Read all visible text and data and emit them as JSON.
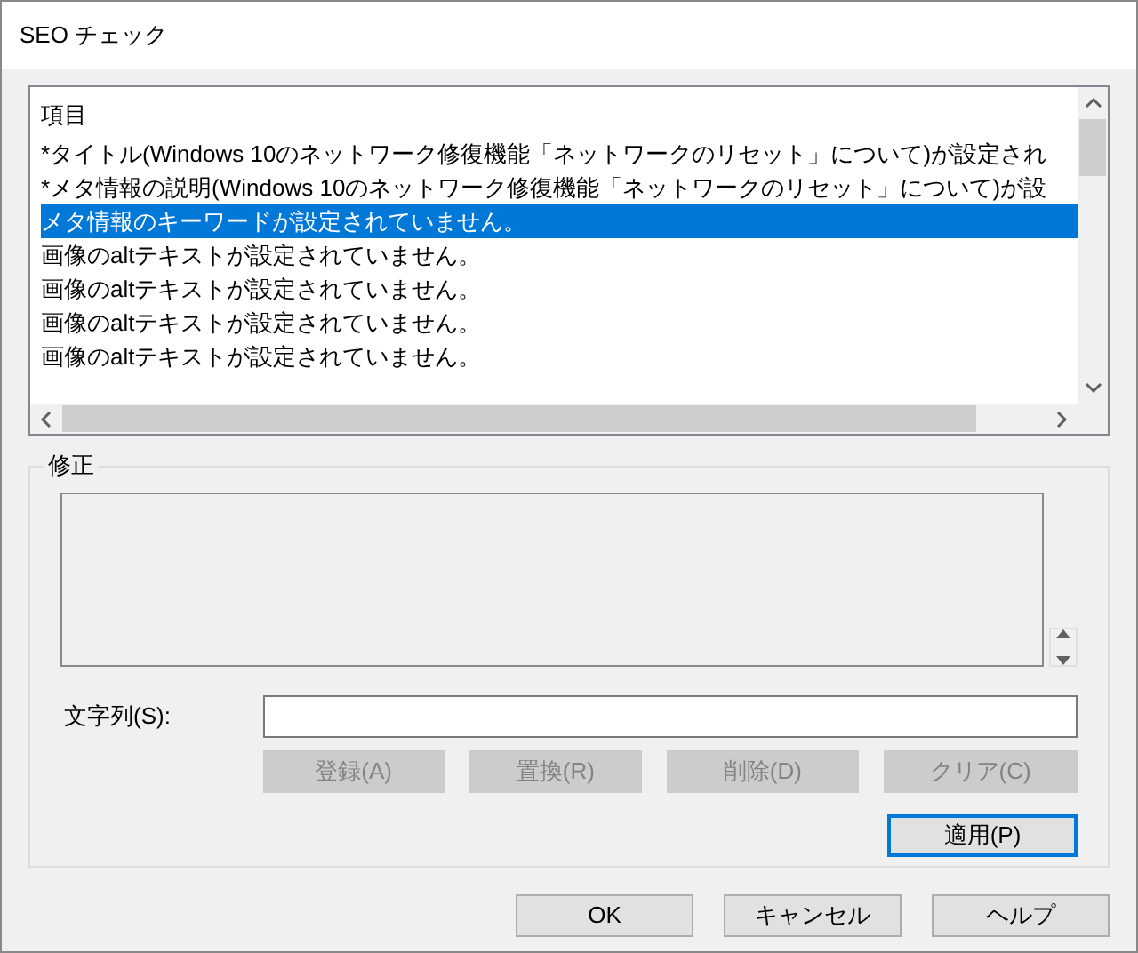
{
  "window": {
    "title": "SEO チェック"
  },
  "list": {
    "header": "項目",
    "rows": [
      {
        "text": "*タイトル(Windows 10のネットワーク修復機能「ネットワークのリセット」について)が設定され",
        "selected": false
      },
      {
        "text": "*メタ情報の説明(Windows 10のネットワーク修復機能「ネットワークのリセット」について)が設",
        "selected": false
      },
      {
        "text": "メタ情報のキーワードが設定されていません。",
        "selected": true
      },
      {
        "text": "画像のaltテキストが設定されていません。",
        "selected": false
      },
      {
        "text": "画像のaltテキストが設定されていません。",
        "selected": false
      },
      {
        "text": "画像のaltテキストが設定されていません。",
        "selected": false
      },
      {
        "text": "画像のaltテキストが設定されていません。",
        "selected": false
      }
    ]
  },
  "fix_group": {
    "title": "修正",
    "string_label": "文字列(S):",
    "actions": [
      {
        "label": "登録(A)",
        "disabled": true
      },
      {
        "label": "置換(R)",
        "disabled": true
      },
      {
        "label": "削除(D)",
        "disabled": true
      },
      {
        "label": "クリア(C)",
        "disabled": true
      }
    ],
    "apply_button": "適用(P)"
  },
  "buttons": [
    "OK",
    "キャンセル",
    "ヘルプ"
  ]
}
